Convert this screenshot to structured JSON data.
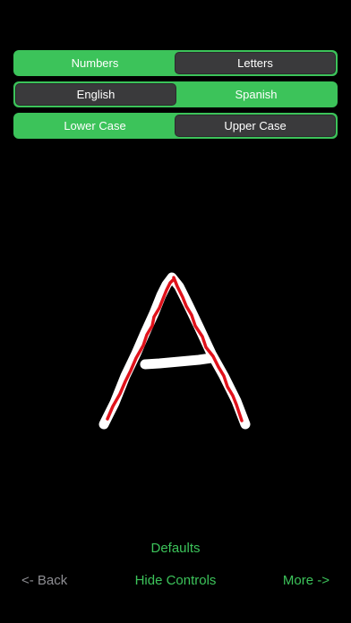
{
  "segment_number_letter": {
    "options": [
      "Numbers",
      "Letters"
    ],
    "selected": "Letters"
  },
  "segment_language": {
    "options": [
      "English",
      "Spanish"
    ],
    "selected": "English"
  },
  "segment_case": {
    "options": [
      "Lower Case",
      "Upper Case"
    ],
    "selected": "Upper Case"
  },
  "canvas": {
    "letter": "A",
    "guide_color": "#ffffff",
    "trace_color": "#e0121b"
  },
  "footer": {
    "defaults_label": "Defaults",
    "back_label": "<- Back",
    "hide_controls_label": "Hide Controls",
    "more_label": "More ->"
  },
  "colors": {
    "accent": "#3cc35a",
    "selected_segment": "#3a3a3c",
    "disabled_text": "#8e8e93",
    "background": "#000000"
  }
}
